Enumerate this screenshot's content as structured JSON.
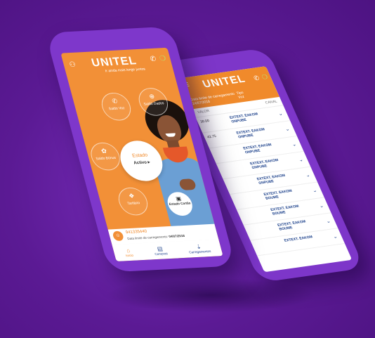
{
  "front": {
    "logo": "UNITEL",
    "logo_sub": "Ir ainda mais longe juntos",
    "buttons": {
      "saldo_voz": "Saldo Voz",
      "saldo_dados": "Saldo Dados",
      "saldo_bonus": "Saldo Bónus",
      "tarifario": "Tarifário"
    },
    "estado": {
      "title": "Estado",
      "value": "Activo ▸"
    },
    "estado_cartao": "Estado Cartão",
    "phone_number": "941335440",
    "limit_label": "Data limite de carregamento:",
    "limit_date": "04/07/2018",
    "tabs": [
      "Início",
      "Compras",
      "Carregamentos"
    ]
  },
  "back": {
    "logo": "UNITEL",
    "filter_label": "Data limite de carregamento",
    "filter_date": "24/07/2018",
    "type_label": "Tipo",
    "type_value": "Voz",
    "col_value": "VALOR",
    "col_channel": "CANAL",
    "rows": [
      {
        "value": "30.00",
        "entity": "EXTEXT. EAKOM ONPUBE"
      },
      {
        "value": "42.75",
        "entity": "EXTEXT. EAKOM ONPUBE"
      },
      {
        "value": "",
        "entity": "EXTEXT. EAKOM ONPUBE"
      },
      {
        "value": "",
        "entity": "EXTEXT. EAKOM ONPUBE"
      },
      {
        "value": "",
        "entity": "EXTEXT. EAKOM ONPUBE"
      },
      {
        "value": "",
        "entity": "EXTEXT. EAKOM BOUME"
      },
      {
        "value": "",
        "entity": "EXTEXT. EAKOM BOUME"
      },
      {
        "value": "",
        "entity": "EXTEXT. EAKOM BOUME"
      },
      {
        "value": "",
        "entity": "EXTEXT. EAKOM"
      }
    ]
  },
  "colors": {
    "orange": "#f29037",
    "purple": "#5a1a92",
    "navy": "#1a3f8a"
  }
}
